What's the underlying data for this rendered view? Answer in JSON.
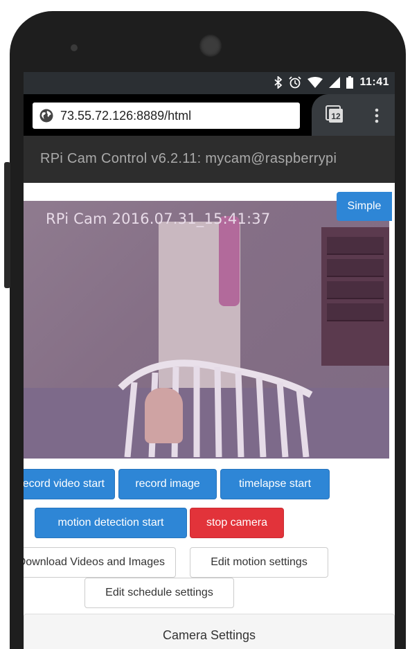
{
  "status_bar": {
    "time": "11:41",
    "icons": [
      "bluetooth-icon",
      "alarm-icon",
      "wifi-icon",
      "signal-icon",
      "battery-icon"
    ]
  },
  "browser": {
    "url": "73.55.72.126:8889/html",
    "tab_count": "12"
  },
  "app": {
    "title": "RPi Cam Control v6.2.11: mycam@raspberrypi"
  },
  "preview": {
    "timestamp": "RPi Cam  2016.07.31_15:41:37"
  },
  "buttons": {
    "simple": "Simple",
    "record_video": "record video start",
    "record_image": "record image",
    "timelapse": "timelapse start",
    "motion_detection": "motion detection start",
    "stop_camera": "stop camera",
    "download": "Download Videos and Images",
    "edit_motion": "Edit motion settings",
    "edit_schedule": "Edit schedule settings"
  },
  "panel": {
    "title": "Camera Settings"
  },
  "colors": {
    "primary": "#2e86d6",
    "danger": "#e2333a",
    "header_bg": "#2d2d2d"
  }
}
